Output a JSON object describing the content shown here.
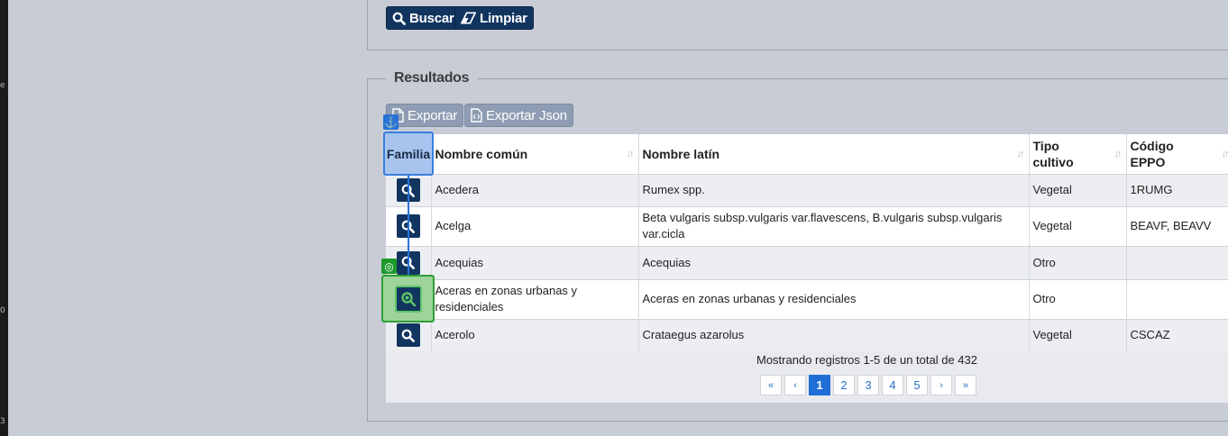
{
  "side_strip": [
    "e",
    "0",
    "3"
  ],
  "search_form": {
    "search_label": "Buscar",
    "clear_label": "Limpiar"
  },
  "results": {
    "legend": "Resultados",
    "export_label": "Exportar",
    "export_json_label": "Exportar Json",
    "columns": [
      "Familia",
      "Nombre común",
      "Nombre latín",
      "Tipo cultivo",
      "Código EPPO"
    ],
    "rows": [
      {
        "common": "Acedera",
        "latin": "Rumex spp.",
        "type": "Vegetal",
        "eppo": "1RUMG"
      },
      {
        "common": "Acelga",
        "latin": "Beta vulgaris subsp.vulgaris var.flavescens, B.vulgaris subsp.vulgaris var.cicla",
        "type": "Vegetal",
        "eppo": "BEAVF, BEAVV"
      },
      {
        "common": "Acequias",
        "latin": "Acequias",
        "type": "Otro",
        "eppo": ""
      },
      {
        "common": "Aceras en zonas urbanas y residenciales",
        "latin": "Aceras en zonas urbanas y residenciales",
        "type": "Otro",
        "eppo": ""
      },
      {
        "common": "Acerolo",
        "latin": "Crataegus azarolus",
        "type": "Vegetal",
        "eppo": "CSCAZ"
      }
    ],
    "summary": "Mostrando registros 1-5 de un total de 432",
    "pagination": {
      "first": "«",
      "prev": "‹",
      "pages": [
        "1",
        "2",
        "3",
        "4",
        "5"
      ],
      "current": "1",
      "next": "›",
      "last": "»"
    }
  },
  "overlay": {
    "anchor_icon": "anchor-icon",
    "target_icon": "target-icon"
  },
  "colors": {
    "navy_button": "#123560",
    "grey_button": "#8e9db3",
    "anchor_blue": "#2a72d8",
    "target_green": "#2c9e33",
    "page_active": "#1f6fd6"
  }
}
